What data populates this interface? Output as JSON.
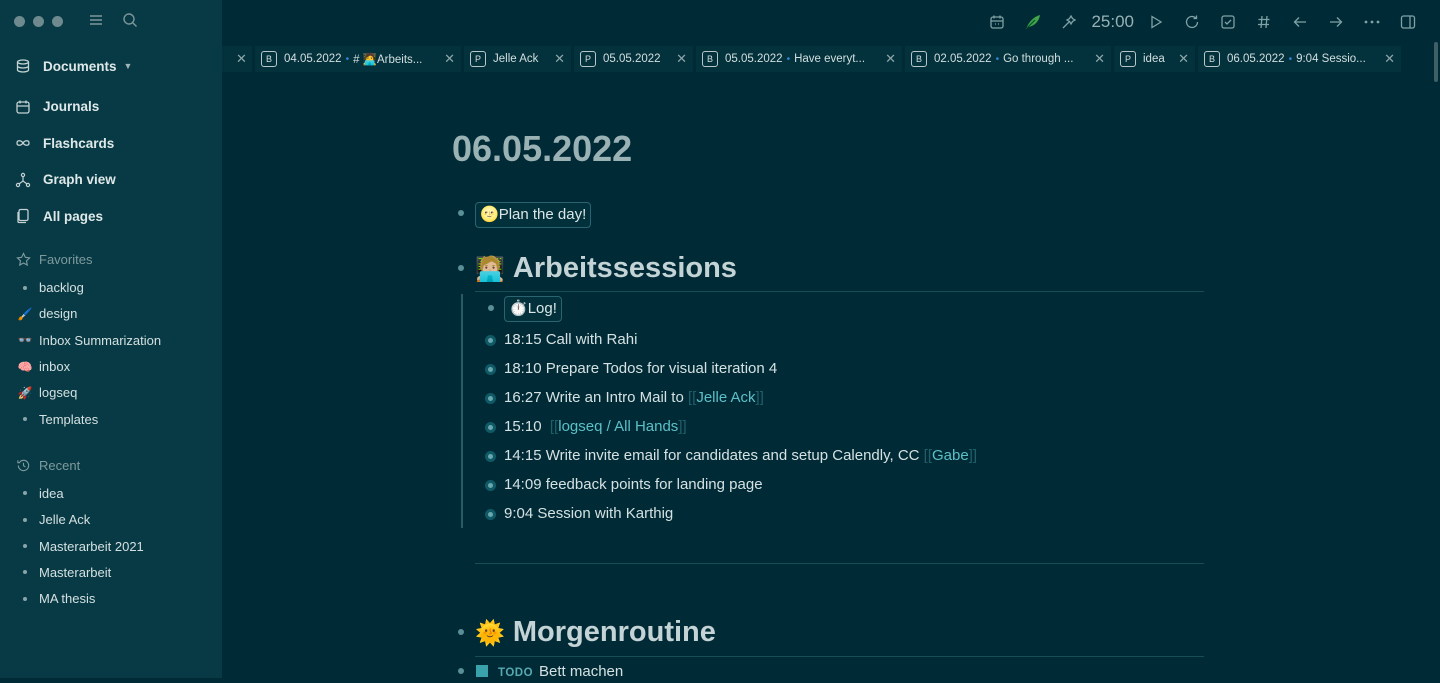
{
  "sidebar": {
    "nav": [
      {
        "label": "Documents",
        "icon": "database-icon",
        "has_caret": true
      },
      {
        "label": "Journals",
        "icon": "calendar-icon"
      },
      {
        "label": "Flashcards",
        "icon": "infinity-icon"
      },
      {
        "label": "Graph view",
        "icon": "graph-icon"
      },
      {
        "label": "All pages",
        "icon": "pages-icon"
      }
    ],
    "favorites_title": "Favorites",
    "favorites": [
      {
        "label": "backlog",
        "emoji": ""
      },
      {
        "label": "design",
        "emoji": "🖌️"
      },
      {
        "label": "Inbox Summarization",
        "emoji": "👓"
      },
      {
        "label": "inbox",
        "emoji": "🧠"
      },
      {
        "label": "logseq",
        "emoji": "🚀"
      },
      {
        "label": "Templates",
        "emoji": ""
      }
    ],
    "recent_title": "Recent",
    "recent": [
      {
        "label": "idea"
      },
      {
        "label": "Jelle Ack"
      },
      {
        "label": "Masterarbeit 2021"
      },
      {
        "label": "Masterarbeit"
      },
      {
        "label": "MA thesis"
      }
    ]
  },
  "toolbar": {
    "timer": "25:00",
    "icons": [
      "calendar-icon",
      "feather-icon",
      "tools-icon",
      "play-icon",
      "refresh-icon",
      "checkbox-icon",
      "hash-icon",
      "arrow-left-icon",
      "arrow-right-icon",
      "more-icon",
      "sidebar-toggle-icon"
    ]
  },
  "tabs": [
    {
      "badge": "",
      "title": "",
      "sub": ""
    },
    {
      "badge": "B",
      "title": "04.05.2022",
      "sub": "# 🧑‍💻Arbeits..."
    },
    {
      "badge": "P",
      "title": "Jelle Ack",
      "sub": ""
    },
    {
      "badge": "P",
      "title": "05.05.2022",
      "sub": ""
    },
    {
      "badge": "B",
      "title": "05.05.2022",
      "sub": "Have everyt..."
    },
    {
      "badge": "B",
      "title": "02.05.2022",
      "sub": "Go through ..."
    },
    {
      "badge": "P",
      "title": "idea",
      "sub": ""
    },
    {
      "badge": "B",
      "title": "06.05.2022",
      "sub": "9:04 Sessio..."
    }
  ],
  "page": {
    "title": "06.05.2022",
    "plan_emoji": "🌝",
    "plan_label": "Plan the day!",
    "arbeits_emoji": "🧑🏼‍💻",
    "arbeits_title": "Arbeitssessions",
    "log_emoji": "⏱️",
    "log_label": "Log!",
    "entries": [
      {
        "text": "18:15 Call with Rahi"
      },
      {
        "text": "18:10 Prepare Todos for visual iteration 4"
      },
      {
        "text": "16:27 Write an Intro Mail to",
        "ref": "Jelle Ack"
      },
      {
        "text": "15:10",
        "ref": "logseq / All Hands"
      },
      {
        "text": "14:15 Write invite email for candidates and setup Calendly, CC",
        "ref": "Gabe"
      },
      {
        "text": "14:09 feedback points for landing page"
      },
      {
        "text": "9:04 Session with Karthig"
      }
    ],
    "morgen_emoji": "🌞",
    "morgen_title": "Morgenroutine",
    "todo_marker": "TODO",
    "todo_text": "Bett machen"
  },
  "colors": {
    "background": "#002b36",
    "sidebar": "#073a44",
    "link": "#5cc0c8",
    "accent_green": "#3fa44a"
  }
}
